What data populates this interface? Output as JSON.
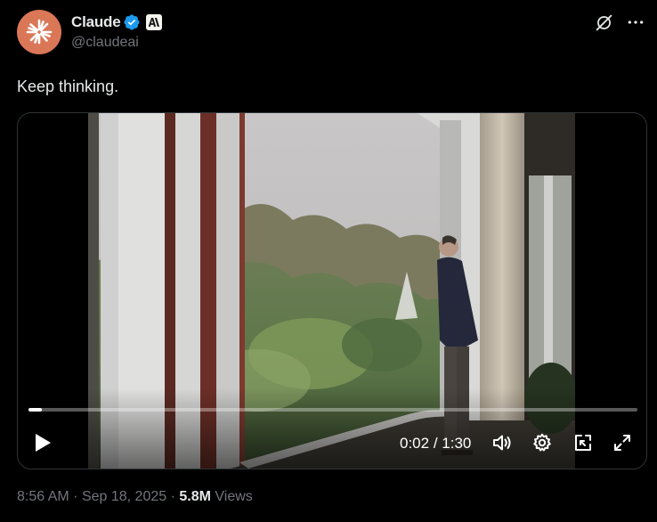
{
  "author": {
    "display_name": "Claude",
    "handle": "@claudeai",
    "avatar_icon": "claude-starburst-icon",
    "avatar_color": "#d97757",
    "verified_icon": "verified-badge-icon",
    "verified_color": "#1d9bf0",
    "affiliate_icon": "anthropic-logo-icon"
  },
  "top_actions": {
    "grok_icon": "grok-icon",
    "more_icon": "more-dots-icon"
  },
  "tweet": {
    "text": "Keep thinking."
  },
  "video": {
    "current_time": "0:02",
    "duration": "1:30",
    "time_display": "0:02 / 1:30",
    "progress_fraction": 0.0222,
    "icons": {
      "play": "play-icon",
      "volume": "volume-icon",
      "settings": "settings-gear-icon",
      "miniplayer": "pop-out-icon",
      "fullscreen": "fullscreen-icon"
    }
  },
  "meta": {
    "time": "8:56 AM",
    "separator": "·",
    "date": "Sep 18, 2025",
    "views_count": "5.8M",
    "views_label": "Views"
  },
  "colors": {
    "background": "#000000",
    "primary_text": "#e7e9ea",
    "secondary_text": "#71767b",
    "border": "#2f3336"
  }
}
